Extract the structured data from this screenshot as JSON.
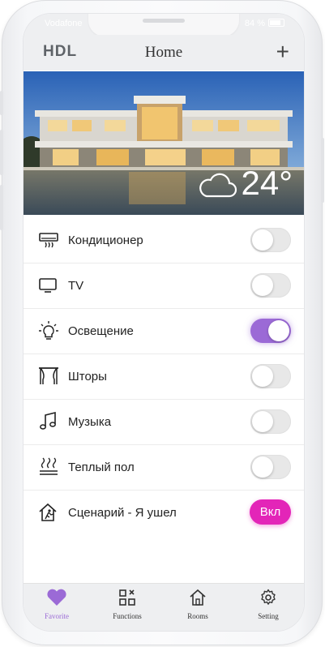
{
  "status": {
    "carrier": "Vodafone",
    "battery": "84 %"
  },
  "header": {
    "logo": "HDL",
    "title": "Home",
    "add": "+"
  },
  "weather": {
    "icon": "cloud-icon",
    "temperature": "24°"
  },
  "devices": [
    {
      "label": "Кондиционер",
      "icon": "air-conditioner-icon",
      "on": false
    },
    {
      "label": "TV",
      "icon": "tv-icon",
      "on": false
    },
    {
      "label": "Освещение",
      "icon": "light-bulb-icon",
      "on": true
    },
    {
      "label": "Шторы",
      "icon": "curtains-icon",
      "on": false
    },
    {
      "label": "Музыка",
      "icon": "music-note-icon",
      "on": false
    },
    {
      "label": "Теплый пол",
      "icon": "floor-heating-icon",
      "on": false
    }
  ],
  "scene": {
    "label": "Сценарий - Я ушел",
    "icon": "house-leaving-icon",
    "button": "Вкл",
    "button_color": "#e325b8"
  },
  "tabs": [
    {
      "label": "Favorite",
      "icon": "heart-icon",
      "active": true
    },
    {
      "label": "Functions",
      "icon": "functions-grid-icon",
      "active": false
    },
    {
      "label": "Rooms",
      "icon": "home-icon",
      "active": false
    },
    {
      "label": "Setting",
      "icon": "gear-icon",
      "active": false
    }
  ],
  "colors": {
    "accent": "#9b6ad6",
    "scene": "#e325b8",
    "bar": "#eeeff1"
  }
}
